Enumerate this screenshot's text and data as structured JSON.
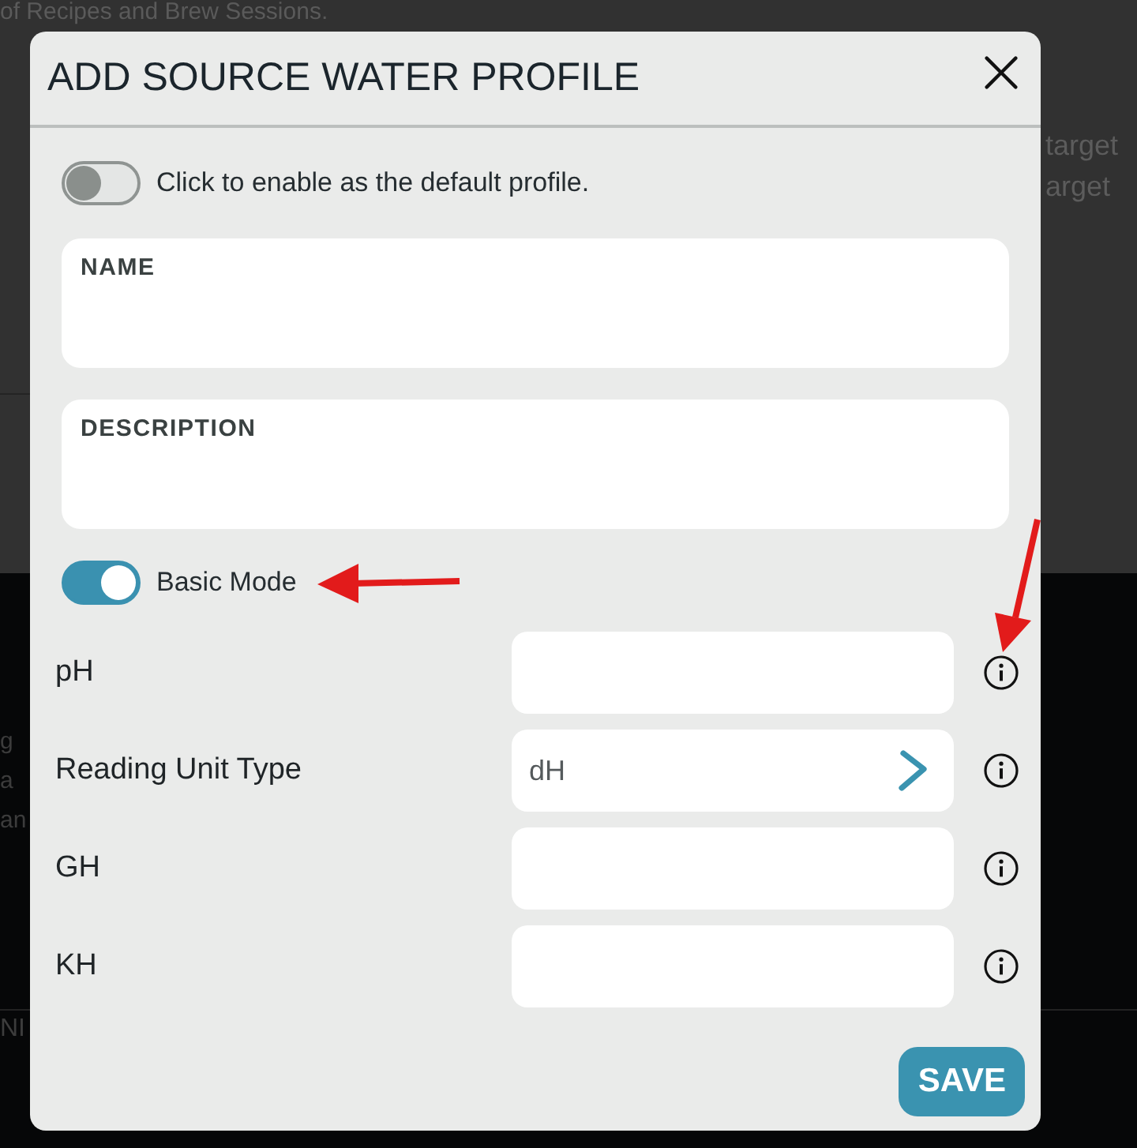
{
  "background_page": {
    "heading": "of Recipes and Brew Sessions.",
    "side_texts": [
      "target",
      "arget"
    ],
    "left_texts": [
      "g",
      "a",
      "an"
    ],
    "footer_text": "NI"
  },
  "dialog": {
    "title": "ADD SOURCE WATER PROFILE",
    "default_toggle": {
      "label": "Click to enable as the default profile.",
      "on": false
    },
    "text_fields": [
      {
        "label": "NAME"
      },
      {
        "label": "DESCRIPTION"
      }
    ],
    "mode_toggle": {
      "label": "Basic Mode",
      "on": true
    },
    "parameters": [
      {
        "label": "pH",
        "kind": "input"
      },
      {
        "label": "Reading Unit Type",
        "kind": "select",
        "value": "dH"
      },
      {
        "label": "GH",
        "kind": "input"
      },
      {
        "label": "KH",
        "kind": "input"
      }
    ],
    "save_button": "SAVE"
  }
}
